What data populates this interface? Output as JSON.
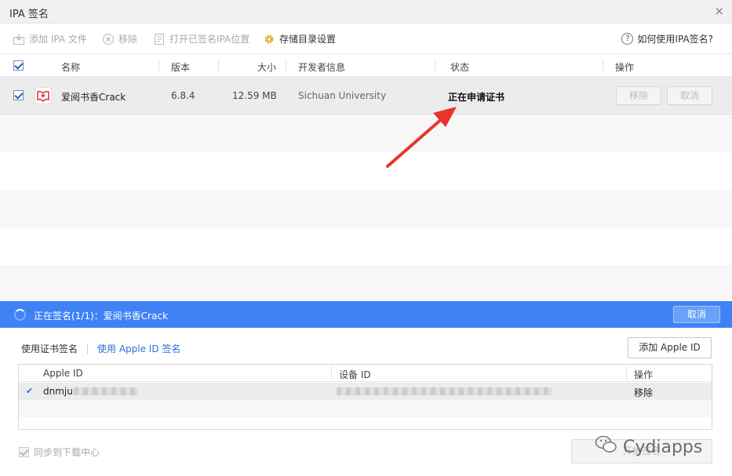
{
  "window": {
    "title": "IPA 签名",
    "close_symbol": "×"
  },
  "toolbar": {
    "add_ipa": "添加 IPA 文件",
    "remove": "移除",
    "open_signed": "打开已签名IPA位置",
    "storage_settings": "存储目录设置",
    "help": "如何使用IPA签名?",
    "help_symbol": "?"
  },
  "table": {
    "headers": {
      "name": "名称",
      "version": "版本",
      "size": "大小",
      "developer": "开发者信息",
      "status": "状态",
      "action": "操作"
    },
    "rows": [
      {
        "name": "爱阅书香Crack",
        "version": "6.8.4",
        "size": "12.59 MB",
        "developer": "Sichuan University",
        "status": "正在申请证书",
        "remove_btn": "移除",
        "cancel_btn": "取消"
      }
    ]
  },
  "progress": {
    "text": "正在签名(1/1)：爱阅书香Crack",
    "cancel": "取消"
  },
  "sign_tabs": {
    "cert": "使用证书签名",
    "apple_id": "使用 Apple ID 签名"
  },
  "add_apple_id": "添加 Apple ID",
  "accounts": {
    "headers": {
      "apple_id": "Apple ID",
      "device_id": "设备 ID",
      "action": "操作"
    },
    "rows": [
      {
        "apple_id": "dnmju",
        "action": "移除"
      }
    ]
  },
  "sync_label": "同步到下载中心",
  "start_sign": "开始签名",
  "watermark": "Cydiapps",
  "colors": {
    "accent": "#3f82f5",
    "link": "#2e70d8",
    "arrow": "#e8352b",
    "app_icon": "#e23b2e"
  }
}
